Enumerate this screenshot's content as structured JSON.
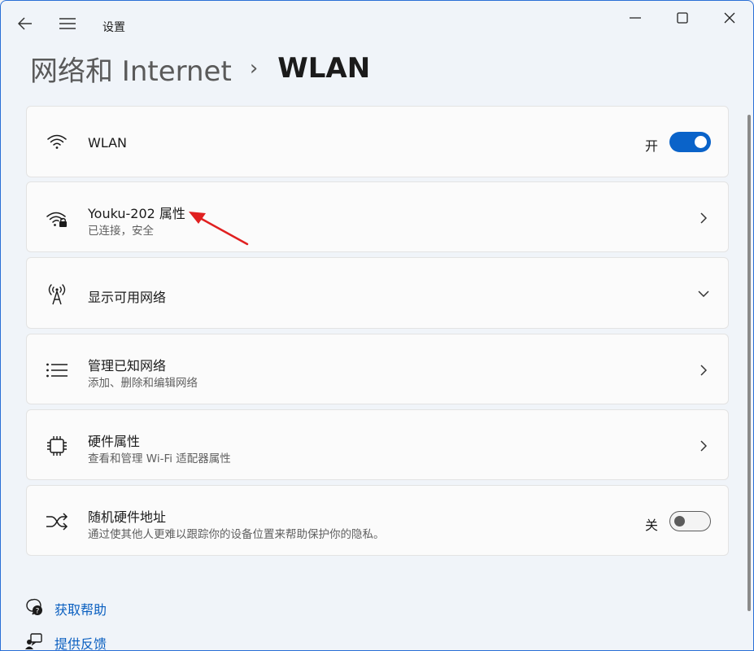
{
  "titlebar": {
    "app_title": "设置",
    "back_icon": "back-arrow-icon",
    "menu_icon": "hamburger-menu-icon",
    "minimize_icon": "minimize-icon",
    "maximize_icon": "maximize-icon",
    "close_icon": "close-icon"
  },
  "breadcrumb": {
    "parent": "网络和 Internet",
    "separator": "›",
    "current": "WLAN"
  },
  "cards": [
    {
      "id": "wlan",
      "icon": "wifi-icon",
      "title": "WLAN",
      "subtitle": "",
      "control": "toggle",
      "toggle_label": "开",
      "toggle_on": true
    },
    {
      "id": "network-properties",
      "icon": "wifi-lock-icon",
      "title": "Youku-202 属性",
      "subtitle": "已连接，安全",
      "control": "chevron-right"
    },
    {
      "id": "show-networks",
      "icon": "antenna-icon",
      "title": "显示可用网络",
      "subtitle": "",
      "control": "chevron-down"
    },
    {
      "id": "manage-known",
      "icon": "list-icon",
      "title": "管理已知网络",
      "subtitle": "添加、删除和编辑网络",
      "control": "chevron-right"
    },
    {
      "id": "hardware-properties",
      "icon": "chip-icon",
      "title": "硬件属性",
      "subtitle": "查看和管理 Wi-Fi 适配器属性",
      "control": "chevron-right"
    },
    {
      "id": "random-hardware-address",
      "icon": "shuffle-icon",
      "title": "随机硬件地址",
      "subtitle": "通过使其他人更难以跟踪你的设备位置来帮助保护你的隐私。",
      "control": "toggle",
      "toggle_label": "关",
      "toggle_on": false
    }
  ],
  "links": [
    {
      "icon": "help-icon",
      "label": "获取帮助"
    },
    {
      "icon": "feedback-icon",
      "label": "提供反馈"
    }
  ],
  "colors": {
    "accent": "#0a63c9",
    "link": "#0a5fc0",
    "annotation": "#e02020"
  }
}
